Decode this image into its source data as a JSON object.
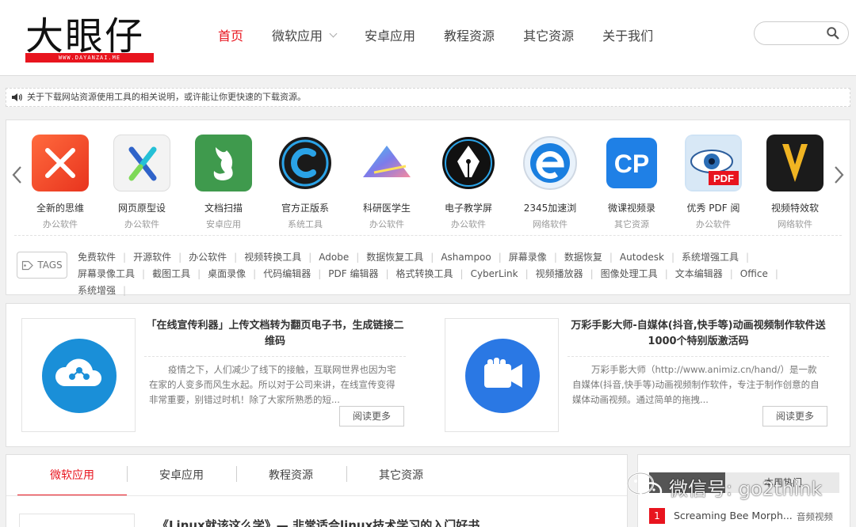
{
  "site": {
    "logo_text": "大眼仔",
    "logo_url": "WWW.DAYANZAI.ME",
    "brand_color": "#e8141e"
  },
  "nav": {
    "items": [
      {
        "label": "首页",
        "active": true
      },
      {
        "label": "微软应用",
        "dropdown": true
      },
      {
        "label": "安卓应用"
      },
      {
        "label": "教程资源"
      },
      {
        "label": "其它资源"
      },
      {
        "label": "关于我们"
      }
    ],
    "search_icon": "search-icon"
  },
  "notice": {
    "icon": "speaker-icon",
    "text": "关于下载网站资源使用工具的相关说明，或许能让你更快速的下载资源。"
  },
  "apps": [
    {
      "name": "全新的思维",
      "category": "办公软件"
    },
    {
      "name": "网页原型设",
      "category": "办公软件"
    },
    {
      "name": "文档扫描",
      "category": "安卓应用"
    },
    {
      "name": "官方正版系",
      "category": "系统工具"
    },
    {
      "name": "科研医学生",
      "category": "办公软件"
    },
    {
      "name": "电子教学屏",
      "category": "办公软件"
    },
    {
      "name": "2345加速浏",
      "category": "网络软件"
    },
    {
      "name": "微课视频录",
      "category": "其它资源"
    },
    {
      "name": "优秀 PDF 阅",
      "category": "办公软件"
    },
    {
      "name": "视频特效软",
      "category": "网络软件"
    }
  ],
  "tags": {
    "label": "TAGS",
    "items": [
      "免费软件",
      "开源软件",
      "办公软件",
      "视频转换工具",
      "Adobe",
      "数据恢复工具",
      "Ashampoo",
      "屏幕录像",
      "数据恢复",
      "Autodesk",
      "系统增强工具",
      "屏幕录像工具",
      "截图工具",
      "桌面录像",
      "代码编辑器",
      "PDF 编辑器",
      "格式转换工具",
      "CyberLink",
      "视频播放器",
      "图像处理工具",
      "文本编辑器",
      "Office",
      "系统增强"
    ]
  },
  "articles": [
    {
      "title": "「在线宣传利器」上传文档转为翻页电子书，生成链接二维码",
      "excerpt": "疫情之下，人们减少了线下的接触，互联网世界也因为宅在家的人变多而风生水起。所以对于公司来讲，在线宣传变得非常重要，别错过时机！除了大家所熟悉的短...",
      "more": "阅读更多"
    },
    {
      "title": "万彩手影大师-自媒体(抖音,快手等)动画视频制作软件送1000个特别版激活码",
      "excerpt": "万彩手影大师（http://www.animiz.cn/hand/）是一款自媒体(抖音,快手等)动画视频制作软件，专注于制作创意的自媒体动画视频。通过简单的拖拽...",
      "more": "阅读更多"
    }
  ],
  "content_tabs": [
    {
      "label": "微软应用",
      "active": true
    },
    {
      "label": "安卓应用"
    },
    {
      "label": "教程资源"
    },
    {
      "label": "其它资源"
    }
  ],
  "post": {
    "title": "《Linux就该这么学》— 非常适合linux技术学习的入门好书"
  },
  "sidebar": {
    "tab_label": "本周热门",
    "ranking": [
      {
        "rank": "1",
        "title": "Screaming Bee Morph...",
        "category": "音频视频"
      }
    ]
  },
  "watermark": {
    "text": "微信号: go2think"
  }
}
